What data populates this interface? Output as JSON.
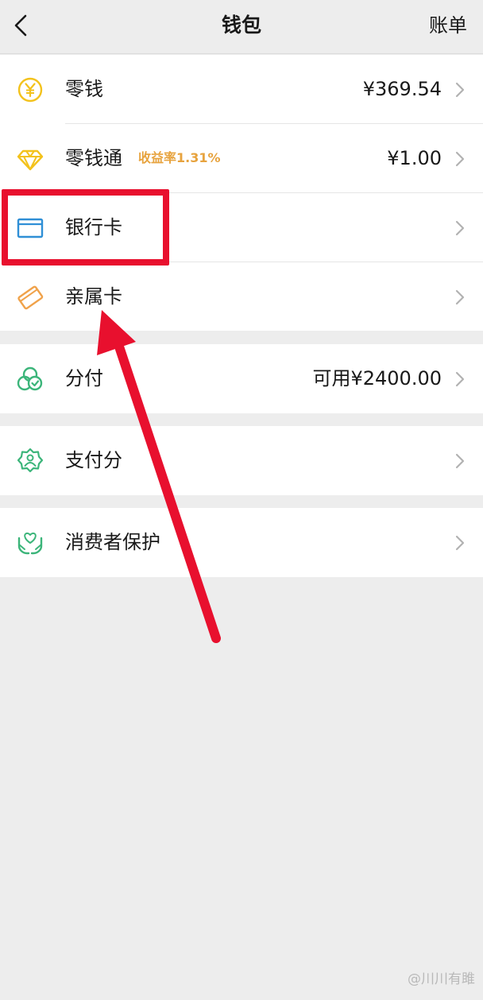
{
  "header": {
    "title": "钱包",
    "right_action": "账单"
  },
  "wallet_items": [
    {
      "label": "零钱",
      "value": "¥369.54",
      "icon": "yuan-coin-icon"
    },
    {
      "label": "零钱通",
      "badge": "收益率1.31%",
      "value": "¥1.00",
      "icon": "diamond-icon"
    },
    {
      "label": "银行卡",
      "icon": "bank-card-icon"
    },
    {
      "label": "亲属卡",
      "icon": "family-card-icon"
    }
  ],
  "fenfu": {
    "label": "分付",
    "value": "可用¥2400.00",
    "icon": "fenfu-icon"
  },
  "payscore": {
    "label": "支付分",
    "icon": "payscore-badge-icon"
  },
  "protection": {
    "label": "消费者保护",
    "icon": "protection-hands-icon"
  },
  "watermark": "@川川有雎",
  "colors": {
    "background": "#ededed",
    "card": "#ffffff",
    "accent_yellow": "#f3c21c",
    "badge_orange": "#e7a33e",
    "green": "#3cb57a",
    "blue": "#2f8fd6",
    "annotation_red": "#e8102e"
  }
}
